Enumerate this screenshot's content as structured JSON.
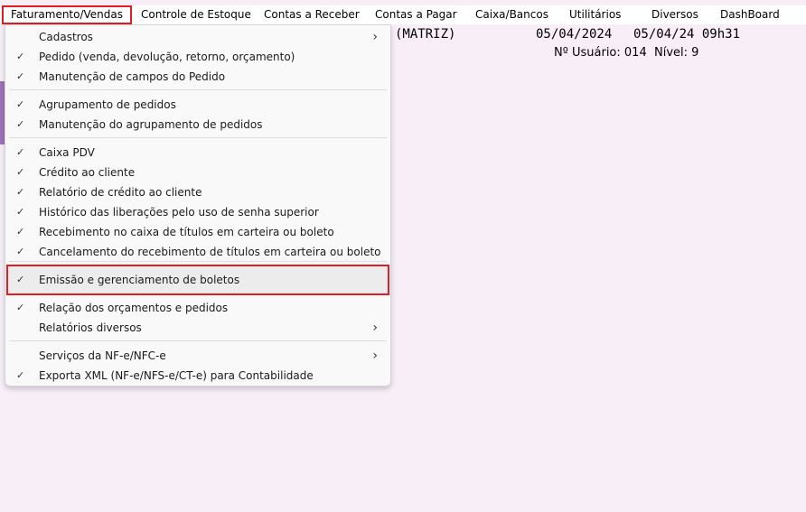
{
  "menubar": {
    "items": [
      "Faturamento/Vendas",
      "Controle de Estoque",
      "Contas a Receber",
      "Contas a Pagar",
      "Caixa/Bancos",
      "Utilitários",
      "Diversos",
      "DashBoard"
    ]
  },
  "header": {
    "company": "(MATRIZ)",
    "date": "05/04/2024",
    "datetime": "05/04/24 09h31",
    "user_label": "Nº Usuário: 014",
    "level_label": "Nível: 9"
  },
  "dropdown": {
    "items": [
      {
        "label": "Cadastros",
        "checked": false,
        "submenu": true
      },
      {
        "label": "Pedido (venda, devolução, retorno, orçamento)",
        "checked": true,
        "submenu": false
      },
      {
        "label": "Manutenção de campos do Pedido",
        "checked": true,
        "submenu": false
      },
      {
        "label": "Agrupamento de pedidos",
        "checked": true,
        "submenu": false
      },
      {
        "label": "Manutenção do agrupamento de pedidos",
        "checked": true,
        "submenu": false
      },
      {
        "label": "Caixa PDV",
        "checked": true,
        "submenu": false
      },
      {
        "label": "Crédito ao cliente",
        "checked": true,
        "submenu": false
      },
      {
        "label": "Relatório de crédito ao cliente",
        "checked": true,
        "submenu": false
      },
      {
        "label": "Histórico das liberações pelo uso de senha superior",
        "checked": true,
        "submenu": false
      },
      {
        "label": "Recebimento no caixa de títulos em carteira ou boleto",
        "checked": true,
        "submenu": false
      },
      {
        "label": "Cancelamento do recebimento de títulos em carteira ou boleto",
        "checked": true,
        "submenu": false
      },
      {
        "label": "Emissão e gerenciamento de boletos",
        "checked": true,
        "submenu": false
      },
      {
        "label": "Relação dos orçamentos e pedidos",
        "checked": true,
        "submenu": false
      },
      {
        "label": "Relatórios diversos",
        "checked": false,
        "submenu": true
      },
      {
        "label": "Serviços da NF-e/NFC-e",
        "checked": false,
        "submenu": true
      },
      {
        "label": "Exporta XML (NF-e/NFS-e/CT-e) para Contabilidade",
        "checked": true,
        "submenu": false
      }
    ],
    "check_glyph": "✓",
    "arrow_glyph": "›"
  }
}
